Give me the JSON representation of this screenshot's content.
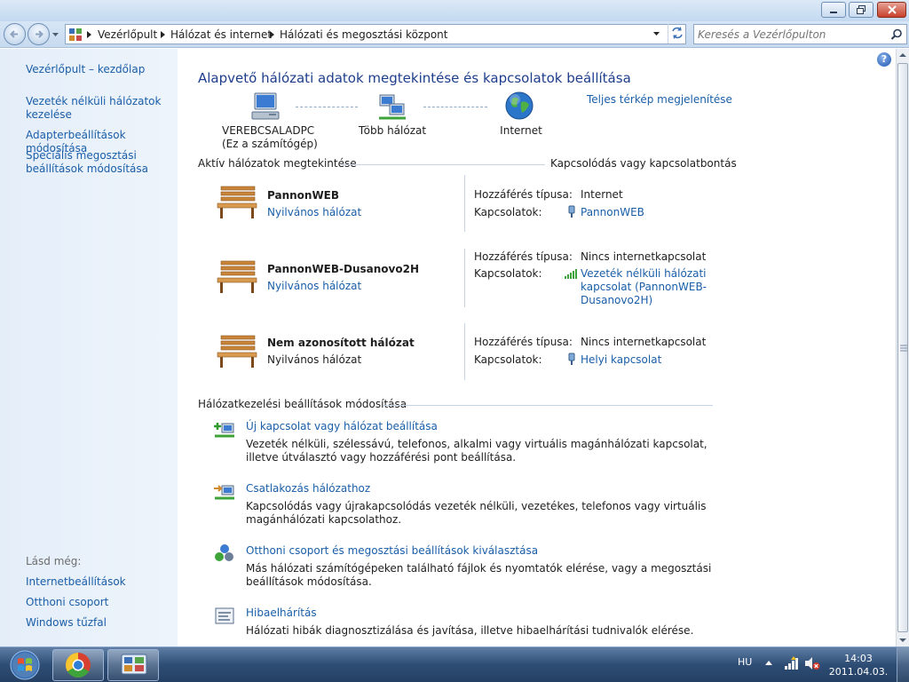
{
  "address": {
    "breadcrumbs": [
      "Vezérlőpult",
      "Hálózat és internet",
      "Hálózati és megosztási központ"
    ]
  },
  "search": {
    "placeholder": "Keresés a Vezérlőpulton"
  },
  "left_pane": {
    "items": [
      {
        "label": "Vezérlőpult – kezdőlap"
      },
      {
        "label": "Vezeték nélküli hálózatok kezelése"
      },
      {
        "label": "Adapterbeállítások módosítása"
      },
      {
        "label": "Speciális megosztási beállítások módosítása"
      }
    ],
    "see_also_label": "Lásd még:",
    "see_also": [
      {
        "label": "Internetbeállítások"
      },
      {
        "label": "Otthoni csoport"
      },
      {
        "label": "Windows tűzfal"
      }
    ]
  },
  "main": {
    "help": "?",
    "title": "Alapvető hálózati adatok megtekintése és kapcsolatok beállítása",
    "full_map_link": "Teljes térkép megjelenítése",
    "map": {
      "computer_name": "VEREBCSALADPC",
      "computer_sub": "(Ez a számítógép)",
      "middle_label": "Több hálózat",
      "internet_label": "Internet"
    },
    "active_header": "Aktív hálózatok megtekintése",
    "connect_link": "Kapcsolódás vagy kapcsolatbontás",
    "access_type_label": "Hozzáférés típusa:",
    "connections_label": "Kapcsolatok:",
    "networks": [
      {
        "name": "PannonWEB",
        "type": "Nyilvános hálózat",
        "access": "Internet",
        "connection": "PannonWEB",
        "connection_icon": "ethernet-plug-icon"
      },
      {
        "name": "PannonWEB-Dusanovo2H",
        "type": "Nyilvános hálózat",
        "access": "Nincs internetkapcsolat",
        "connection": "Vezeték nélküli hálózati kapcsolat (PannonWEB-Dusanovo2H)",
        "connection_icon": "wifi-signal-icon"
      },
      {
        "name": "Nem azonosított hálózat",
        "type": "Nyilvános hálózat",
        "access": "Nincs internetkapcsolat",
        "connection": "Helyi kapcsolat",
        "connection_icon": "ethernet-plug-icon"
      }
    ],
    "settings_header": "Hálózatkezelési beállítások módosítása",
    "tasks": [
      {
        "link": "Új kapcsolat vagy hálózat beállítása",
        "desc": "Vezeték nélküli, szélessávú, telefonos, alkalmi vagy virtuális magánhálózati kapcsolat, illetve útválasztó vagy hozzáférési pont beállítása.",
        "icon": "new-connection-icon"
      },
      {
        "link": "Csatlakozás hálózathoz",
        "desc": "Kapcsolódás vagy újrakapcsolódás vezeték nélküli, vezetékes, telefonos vagy virtuális magánhálózati kapcsolathoz.",
        "icon": "connect-network-icon"
      },
      {
        "link": "Otthoni csoport és megosztási beállítások kiválasztása",
        "desc": "Más hálózati számítógépeken található fájlok és nyomtatók elérése, vagy a megosztási beállítások módosítása.",
        "icon": "homegroup-icon"
      },
      {
        "link": "Hibaelhárítás",
        "desc": "Hálózati hibák diagnosztizálása és javítása, illetve hibaelhárítási tudnivalók elérése.",
        "icon": "troubleshoot-icon"
      }
    ]
  },
  "taskbar": {
    "language": "HU",
    "time": "14:03",
    "date": "2011.04.03."
  },
  "colors": {
    "link": "#1a5ea8",
    "title": "#1e3e8c",
    "left_pane": "#e4eef9",
    "taskbar": "#2e4d75"
  }
}
